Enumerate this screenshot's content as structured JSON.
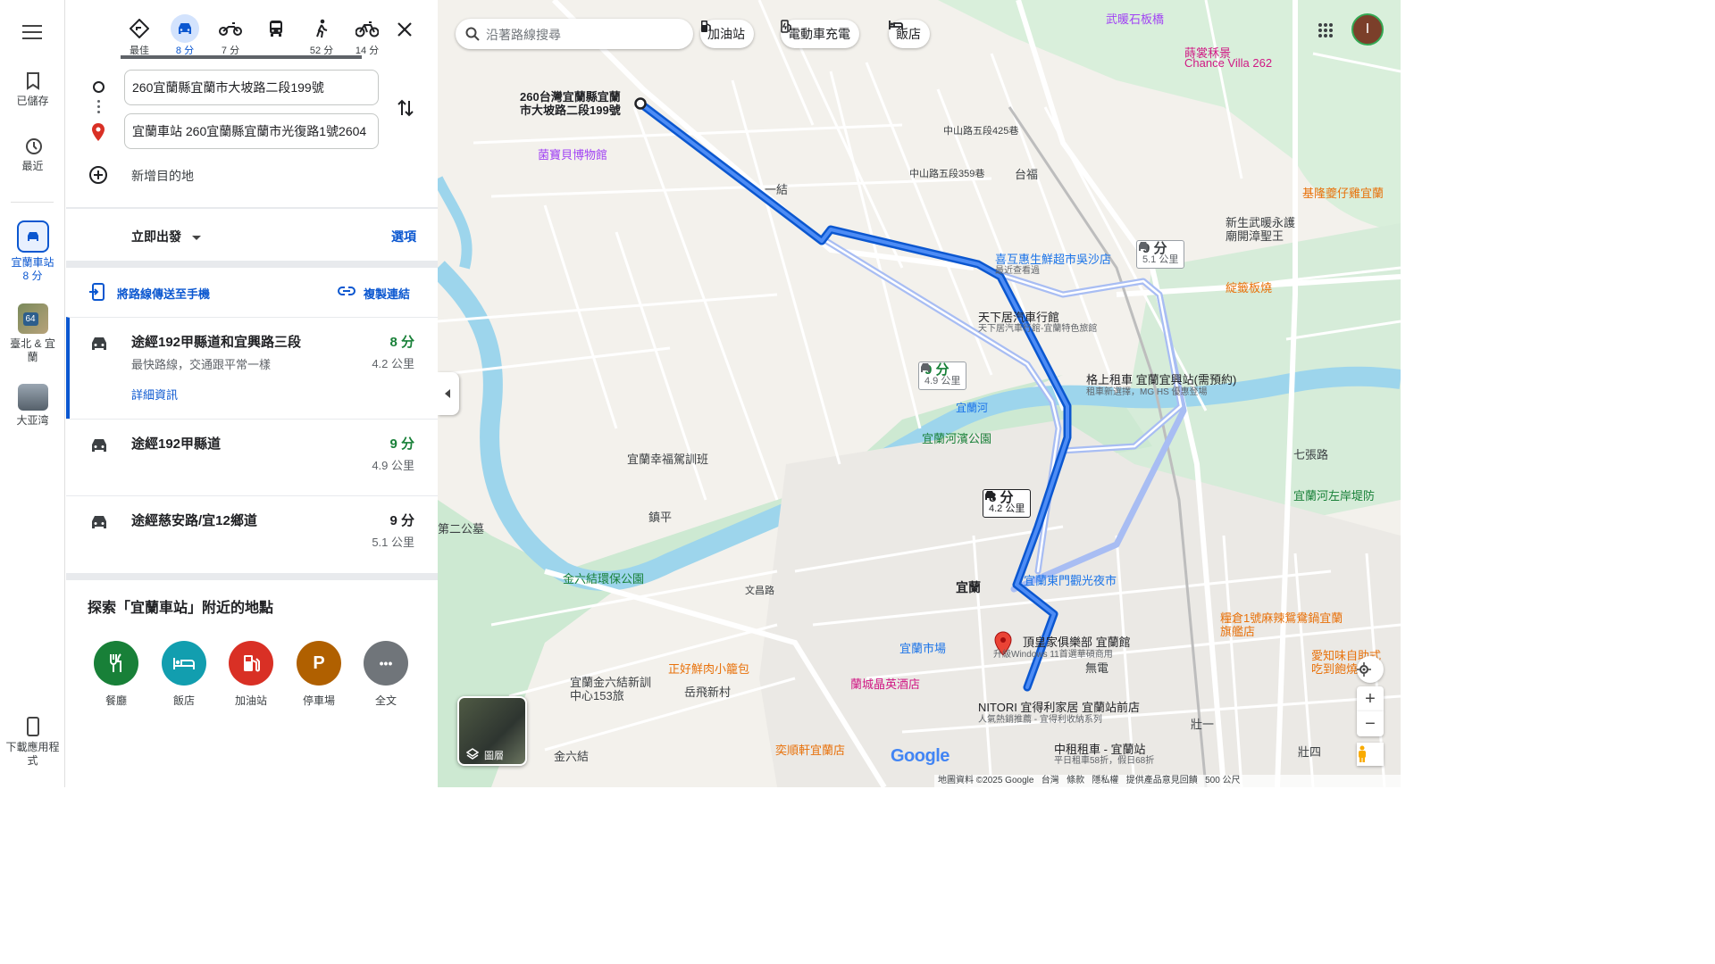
{
  "rail": {
    "saved": "已儲存",
    "recent": "最近",
    "active_dest_line1": "宜蘭車站",
    "active_dest_line2": "8 分",
    "recent_place_1": "臺北 & 宜蘭",
    "recent_place_2": "大亚湾",
    "badge_64": "64",
    "download_app": "下載應用程式"
  },
  "modes": [
    {
      "label": "最佳"
    },
    {
      "label": "8 分"
    },
    {
      "label": "7 分"
    },
    {
      "label": ""
    },
    {
      "label": "52 分"
    },
    {
      "label": "14 分"
    }
  ],
  "origin": "260宜蘭縣宜蘭市大坡路二段199號",
  "destination": "宜蘭車站 260宜蘭縣宜蘭市光復路1號2604",
  "add_destination": "新增目的地",
  "depart_now": "立即出發",
  "options": "選項",
  "send_to_phone": "將路線傳送至手機",
  "copy_link": "複製連結",
  "routes": [
    {
      "title": "途經192甲縣道和宜興路三段",
      "time": "8 分",
      "dist": "4.2 公里",
      "sub": "最快路線，交通跟平常一樣",
      "link": "詳細資訊"
    },
    {
      "title": "途經192甲縣道",
      "time": "9 分",
      "dist": "4.9 公里"
    },
    {
      "title": "途經慈安路/宜12鄉道",
      "time": "9 分",
      "dist": "5.1 公里"
    }
  ],
  "explore_title": "探索「宜蘭車站」附近的地點",
  "categories": [
    {
      "label": "餐廳",
      "color": "#188038",
      "glyph": "🍴"
    },
    {
      "label": "飯店",
      "color": "#129eaf",
      "glyph": "🛏"
    },
    {
      "label": "加油站",
      "color": "#d93025",
      "glyph": "⛽"
    },
    {
      "label": "停車場",
      "color": "#b06000",
      "glyph": "P"
    },
    {
      "label": "全文",
      "color": "#70757a",
      "glyph": "•••"
    }
  ],
  "map": {
    "search_placeholder": "沿著路線搜尋",
    "chip_gas": "加油站",
    "chip_ev": "電動車充電",
    "chip_hotel": "飯店",
    "avatar_letter": "I",
    "origin_label_1": "260台灣宜蘭縣宜蘭",
    "origin_label_2": "市大坡路二段199號",
    "box_main_time": "8 分",
    "box_main_dist": "4.2 公里",
    "box_alt1_time": "9 分",
    "box_alt1_dist": "4.9 公里",
    "box_alt2_time": "9 分",
    "box_alt2_dist": "5.1 公里",
    "layers": "圖層",
    "footer": "地圖資料 ©2025 Google   台灣   條款   隱私權   提供產品意見回饋   500 公尺",
    "google": "Google",
    "places": [
      {
        "name": "菌寶貝博物館"
      },
      {
        "name": "一結"
      },
      {
        "name": "台福"
      },
      {
        "name": "喜互惠生鮮超市吳沙店"
      },
      {
        "name": "最近查看過"
      },
      {
        "name": "天下居汽車行館"
      },
      {
        "name": "天下居汽車行館-宜蘭特色旅館"
      },
      {
        "name": "格上租車 宜蘭宜興站(需預約)"
      },
      {
        "name": "租車新選擇，MG HS 優惠登場"
      },
      {
        "name": "宜蘭河濱公園"
      },
      {
        "name": "宜蘭幸福駕訓班"
      },
      {
        "name": "鎮平"
      },
      {
        "name": "金六結環保公園"
      },
      {
        "name": "宜蘭東門觀光夜市"
      },
      {
        "name": "宜蘭"
      },
      {
        "name": "宜蘭市場"
      },
      {
        "name": "頂皇家俱樂部 宜蘭館"
      },
      {
        "name": "升級Windows 11首選華碩商用"
      },
      {
        "name": "正好鮮肉小籠包"
      },
      {
        "name": "蘭城晶英酒店"
      },
      {
        "name": "岳飛新村"
      },
      {
        "name": "NITORI 宜得利家居 宜蘭站前店"
      },
      {
        "name": "人氣熱銷推薦 - 宜得利收納系列"
      },
      {
        "name": "中租租車 - 宜蘭站"
      },
      {
        "name": "平日租車58折，假日68折"
      },
      {
        "name": "奕順軒宜蘭店"
      },
      {
        "name": "武暖石板橋"
      },
      {
        "name": "蒔裳秝景"
      },
      {
        "name": "Chance Villa 262"
      },
      {
        "name": "基隆夔仔雞宜蘭"
      },
      {
        "name": "新生武暖永護"
      },
      {
        "name": "廟開漳聖王"
      },
      {
        "name": "綻籤板燒"
      },
      {
        "name": "七張路"
      },
      {
        "name": "宜蘭河左岸堤防"
      },
      {
        "name": "糧倉1號麻辣鴛鴦鍋宜蘭旗艦店"
      },
      {
        "name": "愛知味自助式吃到飽燒"
      },
      {
        "name": "宜蘭金六結新訓中心153旅"
      },
      {
        "name": "金六結"
      },
      {
        "name": "無電"
      },
      {
        "name": "壯一"
      },
      {
        "name": "壯四"
      },
      {
        "name": "宜蘭河"
      },
      {
        "name": "第二公墓"
      },
      {
        "name": "文昌路"
      },
      {
        "name": "中山路五段359巷"
      },
      {
        "name": "中山路五段425巷"
      }
    ]
  }
}
